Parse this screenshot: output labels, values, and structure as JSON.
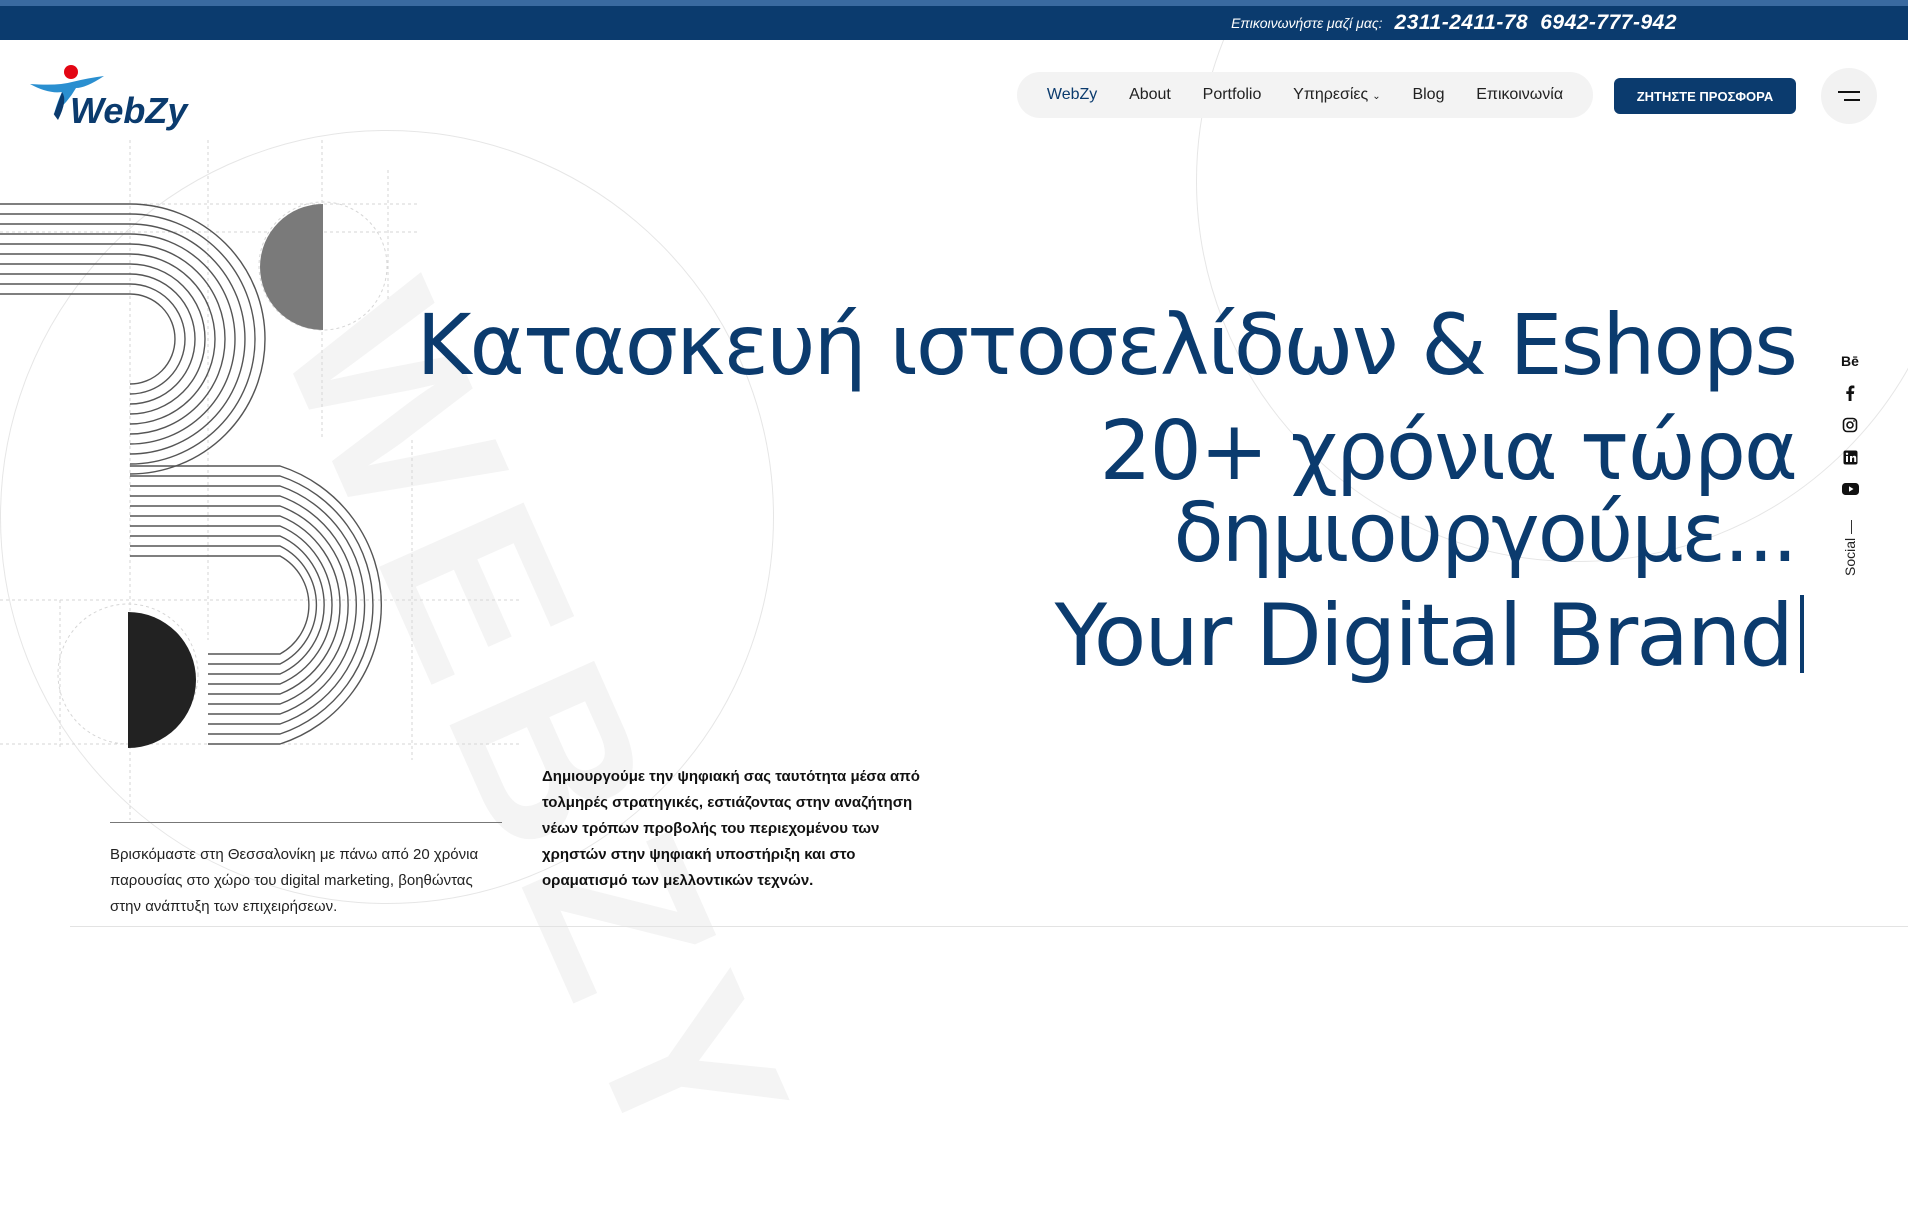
{
  "topbar": {
    "contact_label": "Επικοινωνήστε μαζί μας:",
    "phone_1": "2311-2411-78",
    "phone_2": "6942-777-942"
  },
  "brand": {
    "name": "WebZy",
    "primary_color": "#0b3b6e",
    "accent_color": "#e30613"
  },
  "nav": {
    "items": [
      {
        "label": "WebZy",
        "active": true
      },
      {
        "label": "About"
      },
      {
        "label": "Portfolio"
      },
      {
        "label": "Υπηρεσίες",
        "has_dropdown": true
      },
      {
        "label": "Blog"
      },
      {
        "label": "Επικοινωνία"
      }
    ],
    "cta_label": "ΖΗΤΗΣΤΕ ΠΡΟΣΦΟΡΑ",
    "menu_icon": "hamburger-icon"
  },
  "hero": {
    "line_1": "Κατασκευή ιστοσελίδων & Eshops",
    "line_2": "20+ χρόνια τώρα",
    "line_3": "δημιουργούμε...",
    "line_4": "Your Digital Brand"
  },
  "social": {
    "label": "Social —",
    "icons": [
      "behance-icon",
      "facebook-icon",
      "instagram-icon",
      "linkedin-icon",
      "youtube-icon"
    ],
    "behance_text": "Bē"
  },
  "intro": {
    "text": "Βρισκόμαστε στη Θεσσαλονίκη με πάνω από 20 χρόνια παρουσίας στο χώρο του digital marketing, βοηθώντας στην ανάπτυξη των επιχειρήσεων."
  },
  "description": {
    "text": "Δημιουργούμε την ψηφιακή σας ταυτότητα μέσα από τολμηρές στρατηγικές, εστιάζοντας στην αναζήτηση νέων τρόπων προβολής του περιεχομένου των χρηστών στην ψηφιακή υποστήριξη και στο οραματισμό των μελλοντικών τεχνών."
  },
  "watermark": "WEBZY"
}
